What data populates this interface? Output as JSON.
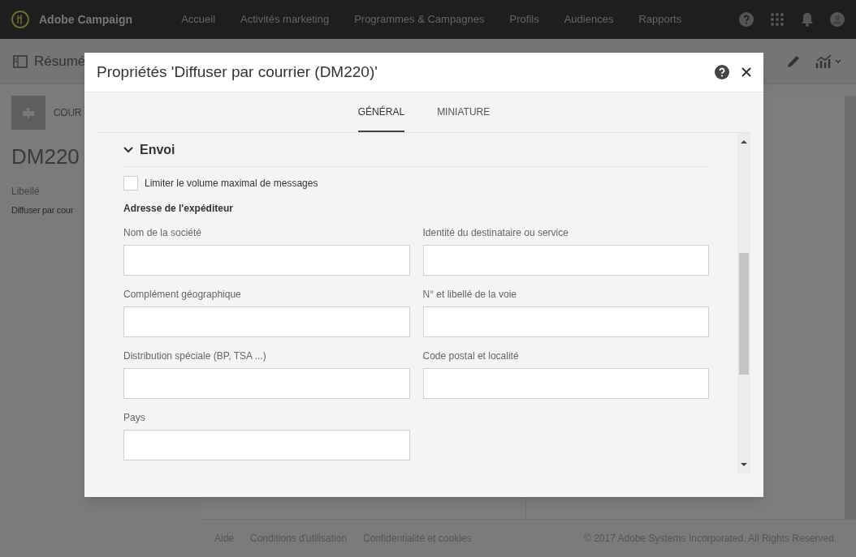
{
  "nav": {
    "brand": "Adobe Campaign",
    "items": [
      "Accueil",
      "Activités marketing",
      "Programmes & Campagnes",
      "Profils",
      "Audiences",
      "Rapports"
    ]
  },
  "toolbar": {
    "title": "Résumé"
  },
  "card": {
    "type_label": "COUR",
    "name": "DM220",
    "field_label": "Libellé",
    "field_value": "Diffuser par cour"
  },
  "footer": {
    "links": [
      "Aide",
      "Conditions d'utilisation",
      "Confidentialité et cookies"
    ],
    "copyright": "© 2017 Adobe Systems Incorporated. All Rights Reserved."
  },
  "dialog": {
    "title": "Propriétés 'Diffuser par courrier (DM220)'",
    "tabs": [
      {
        "label": "GÉNÉRAL",
        "selected": true
      },
      {
        "label": "MINIATURE",
        "selected": false
      }
    ],
    "section": {
      "title": "Envoi",
      "expanded": true
    },
    "checkbox": {
      "label": "Limiter le volume maximal de messages",
      "checked": false
    },
    "subheading": "Adresse de l'expéditeur",
    "fields": [
      {
        "label": "Nom de la société"
      },
      {
        "label": "Identité du destinataire ou service"
      },
      {
        "label": "Complément géographique"
      },
      {
        "label": "N° et libellé de la voie"
      },
      {
        "label": "Distribution spéciale (BP, TSA ...)"
      },
      {
        "label": "Code postal et localité"
      },
      {
        "label": "Pays"
      }
    ]
  }
}
